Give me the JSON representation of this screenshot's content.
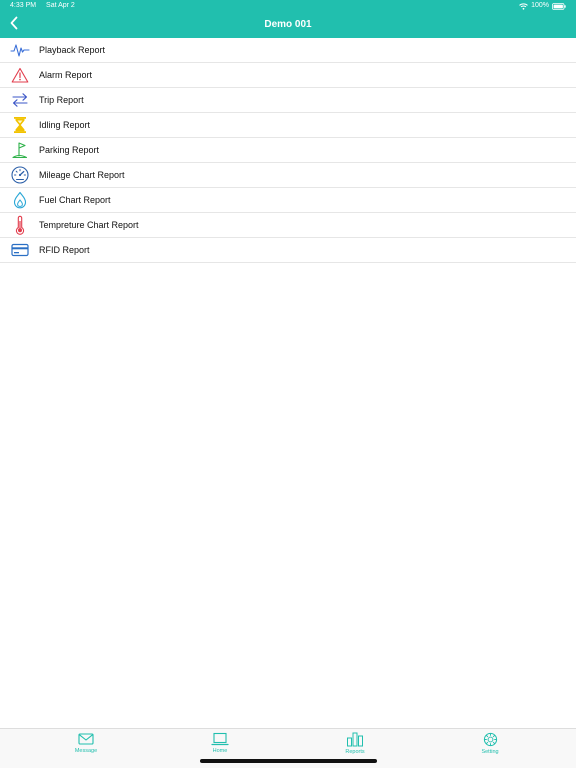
{
  "status_bar": {
    "time": "4:33 PM",
    "date": "Sat Apr 2",
    "battery": "100%"
  },
  "nav": {
    "title": "Demo 001",
    "back_icon": "chevron-left-icon"
  },
  "colors": {
    "accent": "#21bfae",
    "playback": "#3a6fd8",
    "alarm": "#e23c4c",
    "trip": "#3a55c7",
    "idling": "#f2c200",
    "parking": "#2fb24a",
    "mileage": "#2a5ea8",
    "fuel": "#2aa7d6",
    "temperature": "#e23c4c",
    "rfid": "#2a6fc4"
  },
  "reports": [
    {
      "label": "Playback Report",
      "icon": "pulse-icon"
    },
    {
      "label": "Alarm Report",
      "icon": "warning-icon"
    },
    {
      "label": "Trip Report",
      "icon": "swap-arrows-icon"
    },
    {
      "label": "Idling Report",
      "icon": "hourglass-icon"
    },
    {
      "label": "Parking Report",
      "icon": "flag-icon"
    },
    {
      "label": "Mileage Chart Report",
      "icon": "speedometer-icon"
    },
    {
      "label": "Fuel Chart Report",
      "icon": "flame-icon"
    },
    {
      "label": "Tempreture Chart Report",
      "icon": "thermometer-icon"
    },
    {
      "label": "RFID Report",
      "icon": "card-icon"
    }
  ],
  "tabs": [
    {
      "label": "Message",
      "icon": "envelope-icon"
    },
    {
      "label": "Home",
      "icon": "laptop-icon"
    },
    {
      "label": "Reports",
      "icon": "bar-chart-icon"
    },
    {
      "label": "Setting",
      "icon": "gear-icon"
    }
  ]
}
